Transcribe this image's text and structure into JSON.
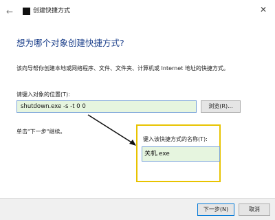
{
  "window": {
    "title": "创建快捷方式",
    "back_glyph": "←",
    "close_glyph": "✕"
  },
  "heading": "想为哪个对象创建快捷方式?",
  "description": "该向导帮你创建本地或网络程序、文件、文件夹、计算机或 Internet 地址的快捷方式。",
  "location": {
    "label": "请键入对象的位置(T):",
    "value": "shutdown.exe -s -t 0 0",
    "browse_label": "浏览(R)..."
  },
  "hint": "单击\"下一步\"继续。",
  "callout": {
    "label": "键入该快捷方式的名称(T):",
    "value": "关机.exe",
    "border_color": "#e8c300"
  },
  "footer": {
    "next_label": "下一步(N)",
    "cancel_label": "取消"
  },
  "colors": {
    "heading": "#1a3e8a",
    "input_fill": "#e6f5df",
    "input_border": "#7aa3d8"
  }
}
